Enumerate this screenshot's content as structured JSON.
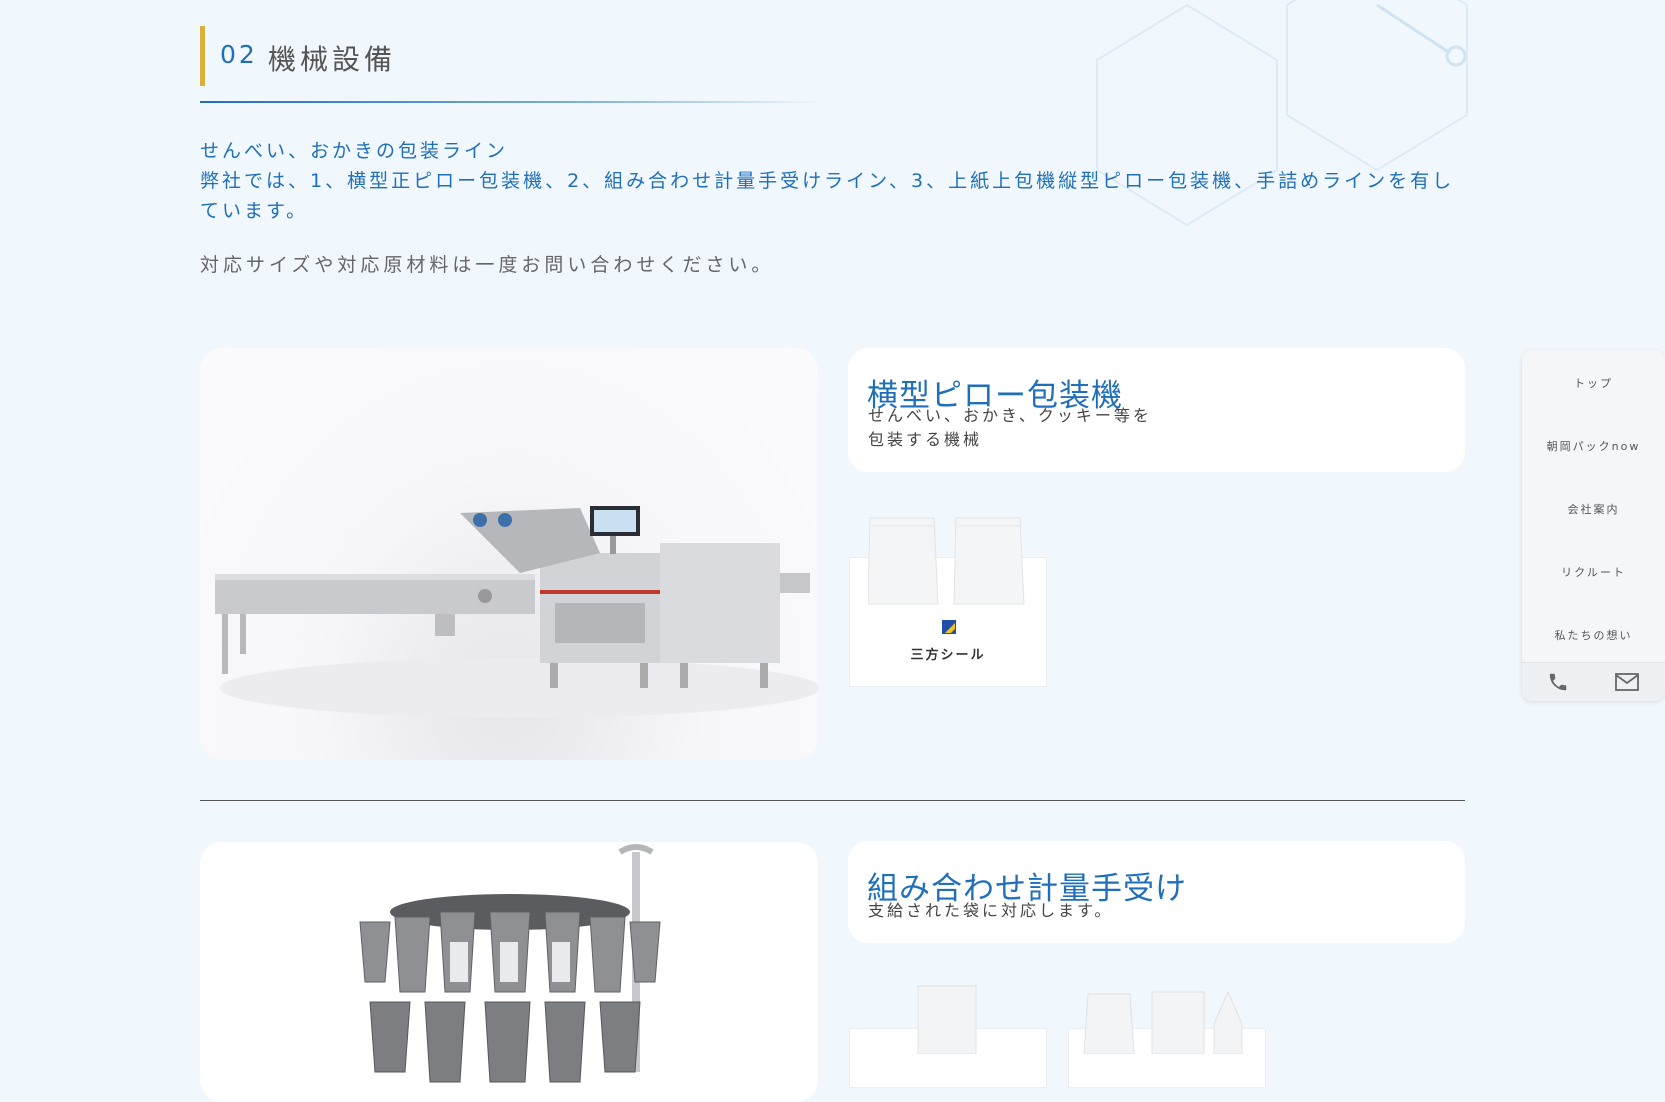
{
  "section": {
    "number": "02",
    "title": "機械設備"
  },
  "intro": {
    "line1": "せんべい、おかきの包装ライン",
    "line2": "弊社では、1、横型正ピロー包装機、2、組み合わせ計量手受けライン、3、上紙上包機縦型ピロー包装機、手詰めラインを有しています。",
    "note": "対応サイズや対応原材料は一度お問い合わせください。"
  },
  "machines": [
    {
      "title": "横型ピロー包装機",
      "desc_lines": [
        "せんべい、おかき、クッキー等を",
        "包装する機械"
      ],
      "packages": [
        {
          "label": "三方シール"
        }
      ]
    },
    {
      "title": "組み合わせ計量手受け",
      "desc_lines": [
        "支給された袋に対応します。"
      ]
    }
  ],
  "side_nav": {
    "items": [
      "トップ",
      "朝岡パックnow",
      "会社案内",
      "リクルート",
      "私たちの想い"
    ]
  },
  "colors": {
    "accent": "#1f6fba",
    "gold": "#d9b23c",
    "background": "#f0f7fd"
  }
}
